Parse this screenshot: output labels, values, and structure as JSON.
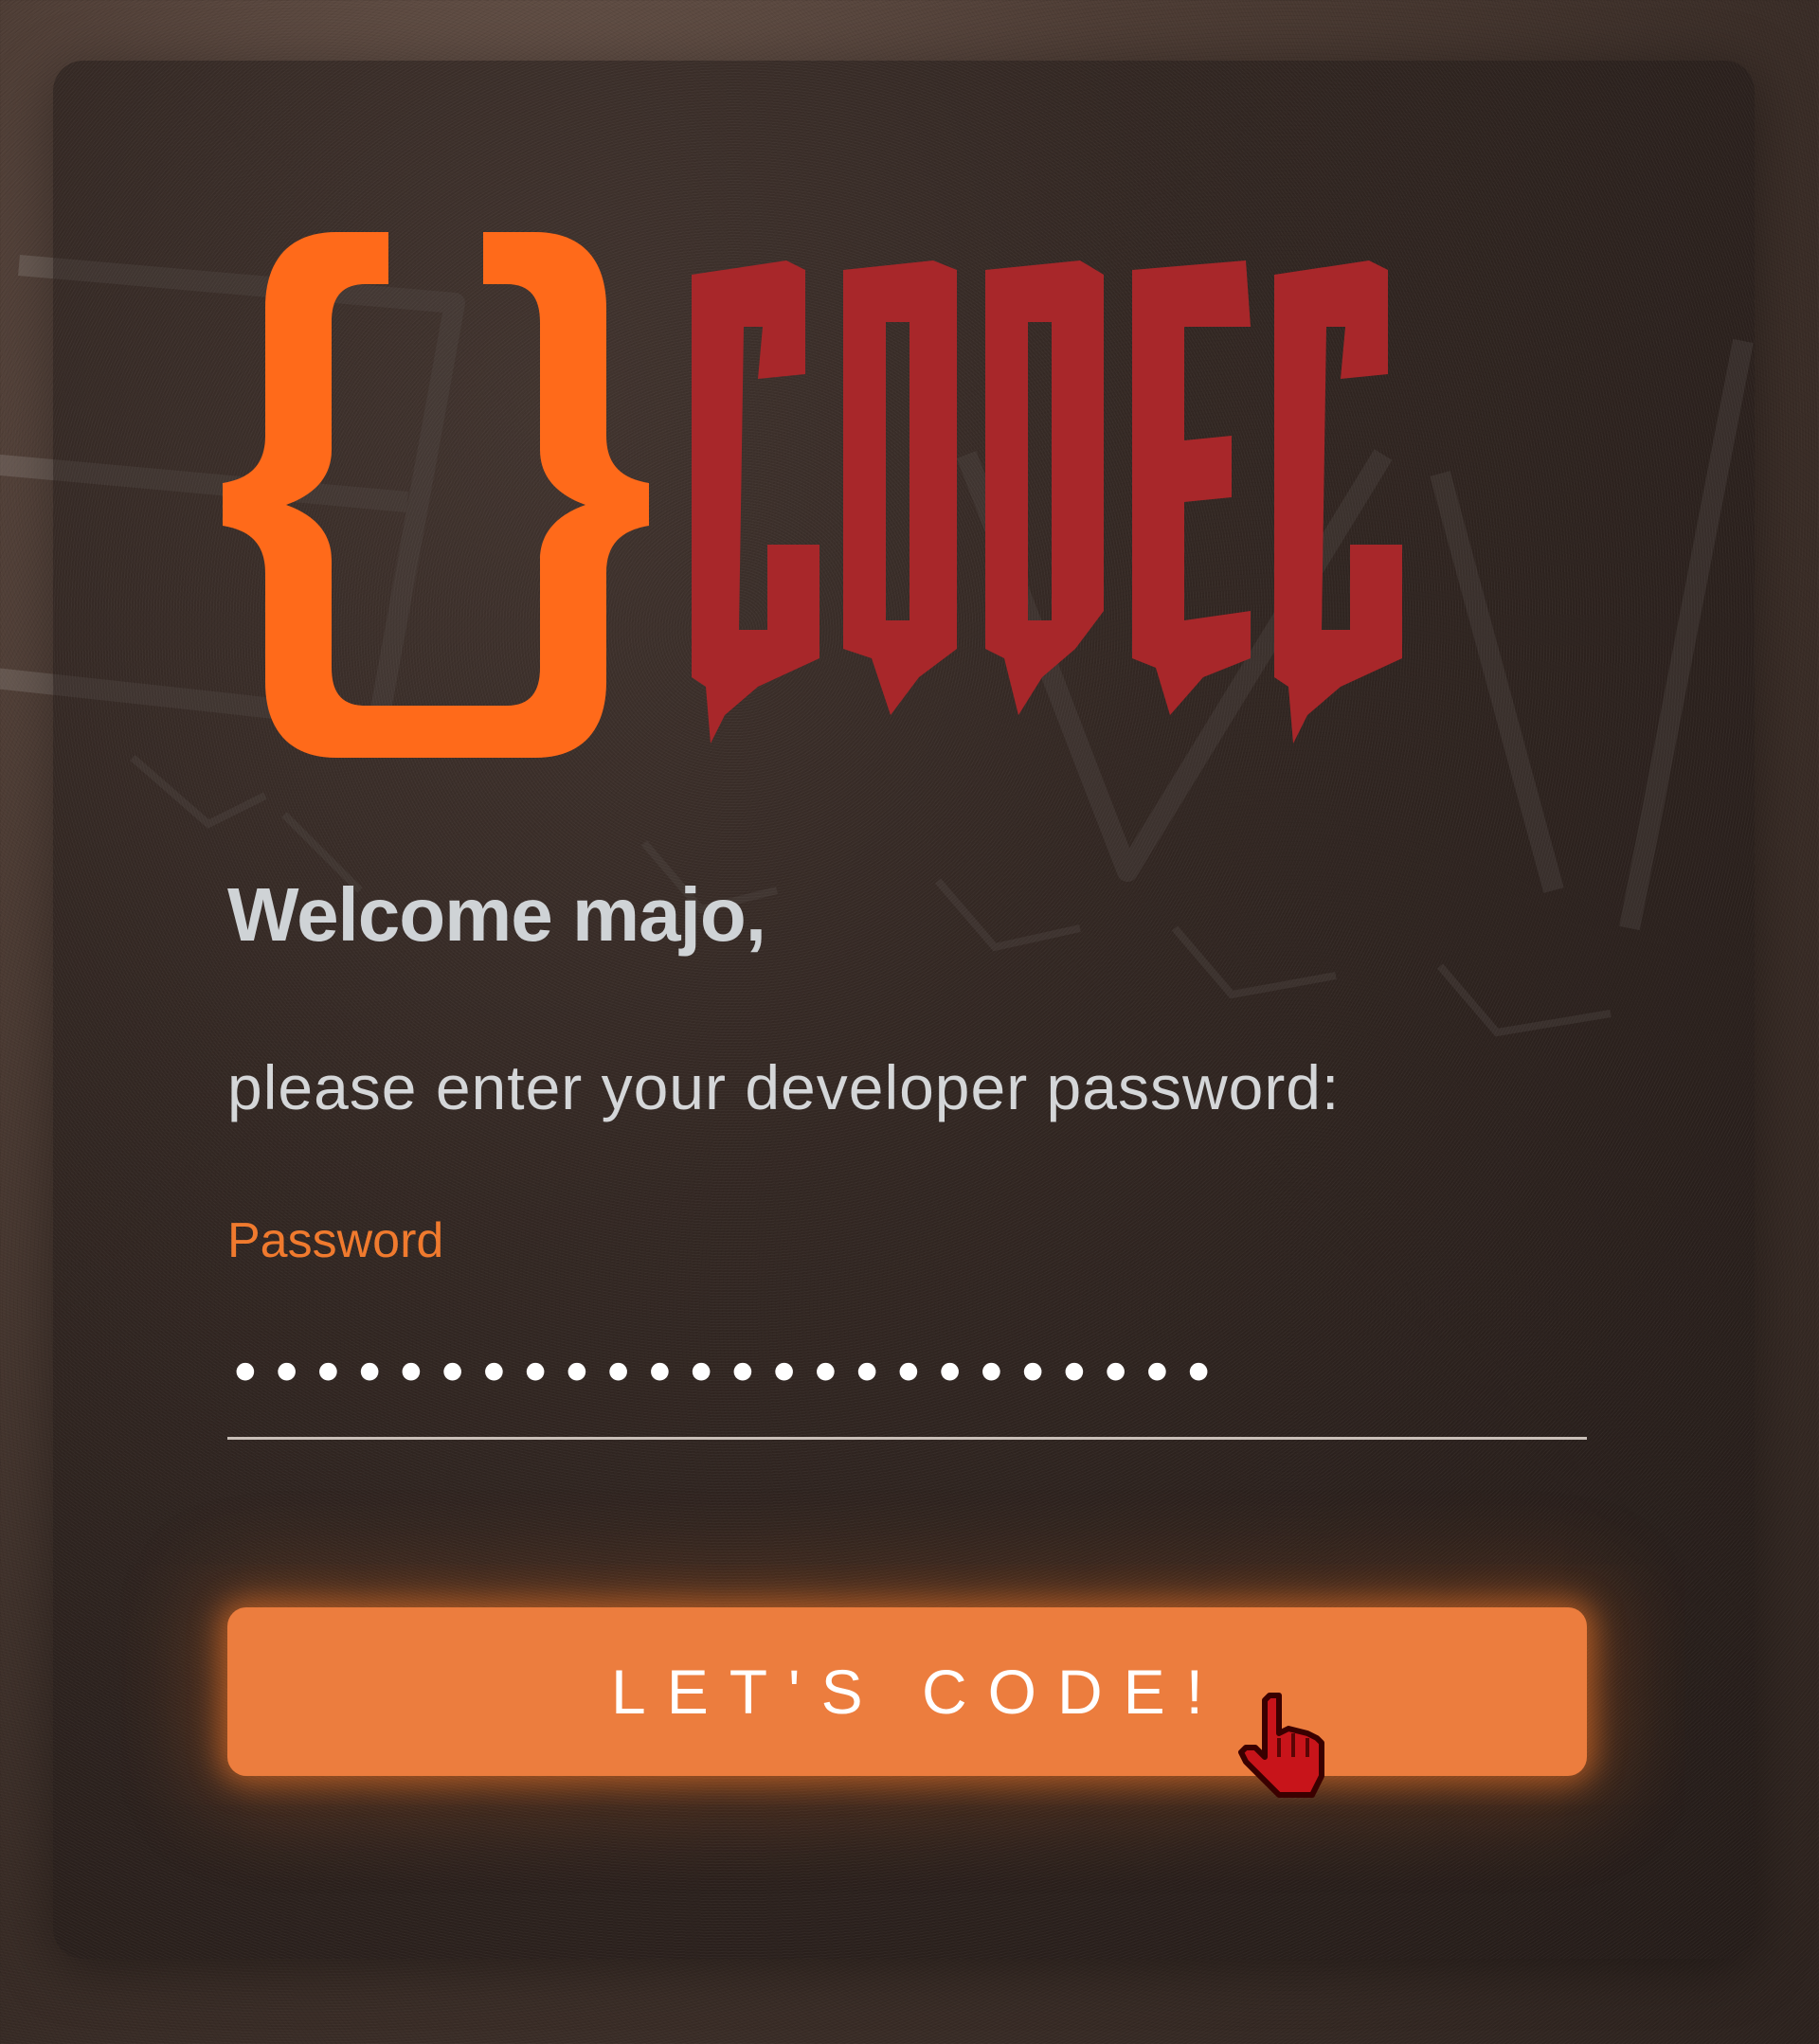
{
  "logo": {
    "braces": "{}",
    "word": "CODEC",
    "brace_color": "#ff6a1a",
    "word_color": "#a8272a"
  },
  "login": {
    "greeting": "Welcome majo,",
    "instruction": "please enter your developer password:",
    "password_label": "Password",
    "password_value": "••••••••••••••••••••••••",
    "submit_label": "LET'S CODE!"
  },
  "colors": {
    "accent": "#f07a2e",
    "button": "#ec7d3e",
    "text": "#d4d6d8"
  },
  "icons": {
    "cursor": "hand-pointer-icon"
  }
}
